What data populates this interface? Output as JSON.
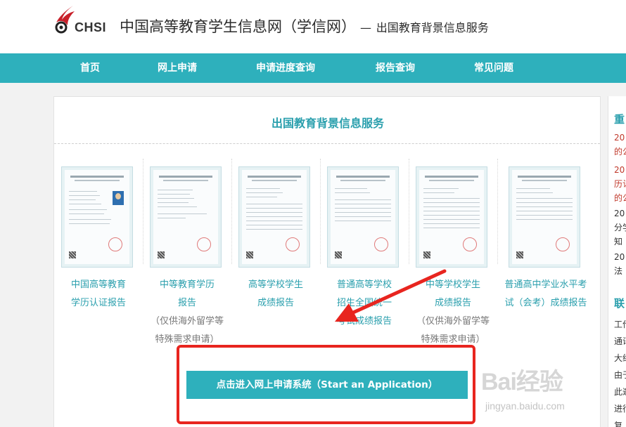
{
  "header": {
    "logo_text": "CHSI",
    "title": "中国高等教育学生信息网（学信网）",
    "dash": "—",
    "subtitle": "出国教育背景信息服务"
  },
  "nav": {
    "items": [
      {
        "label": "首页"
      },
      {
        "label": "网上申请"
      },
      {
        "label": "申请进度查询"
      },
      {
        "label": "报告查询"
      },
      {
        "label": "常见问题"
      }
    ]
  },
  "main": {
    "title": "出国教育背景信息服务",
    "cards": [
      {
        "lines": [
          "中国高等教育",
          "学历认证报告"
        ],
        "note": []
      },
      {
        "lines": [
          "中等教育学历",
          "报告"
        ],
        "note": [
          "（仅供海外留学等",
          "特殊需求申请）"
        ]
      },
      {
        "lines": [
          "高等学校学生",
          "成绩报告"
        ],
        "note": []
      },
      {
        "lines": [
          "普通高等学校",
          "招生全国统一",
          "考试成绩报告"
        ],
        "note": []
      },
      {
        "lines": [
          "中等学校学生",
          "成绩报告"
        ],
        "note": [
          "（仅供海外留学等",
          "特殊需求申请）"
        ]
      },
      {
        "lines": [
          "普通高中学业水平考",
          "试（会考）成绩报告"
        ],
        "note": []
      }
    ],
    "apply_button": "点击进入网上申请系统（Start an Application）"
  },
  "side": {
    "title1": "重",
    "lines1": [
      {
        "text": "20",
        "color": "red"
      },
      {
        "text": "的公",
        "color": "red"
      },
      {
        "text": "20",
        "color": "red"
      },
      {
        "text": "历认",
        "color": "red"
      },
      {
        "text": "的公",
        "color": "red"
      },
      {
        "text": "20",
        "color": "dark"
      },
      {
        "text": "分学",
        "color": "dark"
      },
      {
        "text": "知",
        "color": "dark"
      },
      {
        "text": "20",
        "color": "dark"
      },
      {
        "text": "法",
        "color": "dark"
      }
    ],
    "title2": "联",
    "lines2": [
      "工作",
      "通讯",
      "大约",
      "由于",
      "此邀",
      "进行",
      "复"
    ]
  },
  "watermark": {
    "brand": "Bai经验",
    "url": "jingyan.baidu.com"
  },
  "colors": {
    "teal": "#2eb0bc",
    "teal_text": "#2a9fad",
    "annotation_red": "#e8251f"
  }
}
